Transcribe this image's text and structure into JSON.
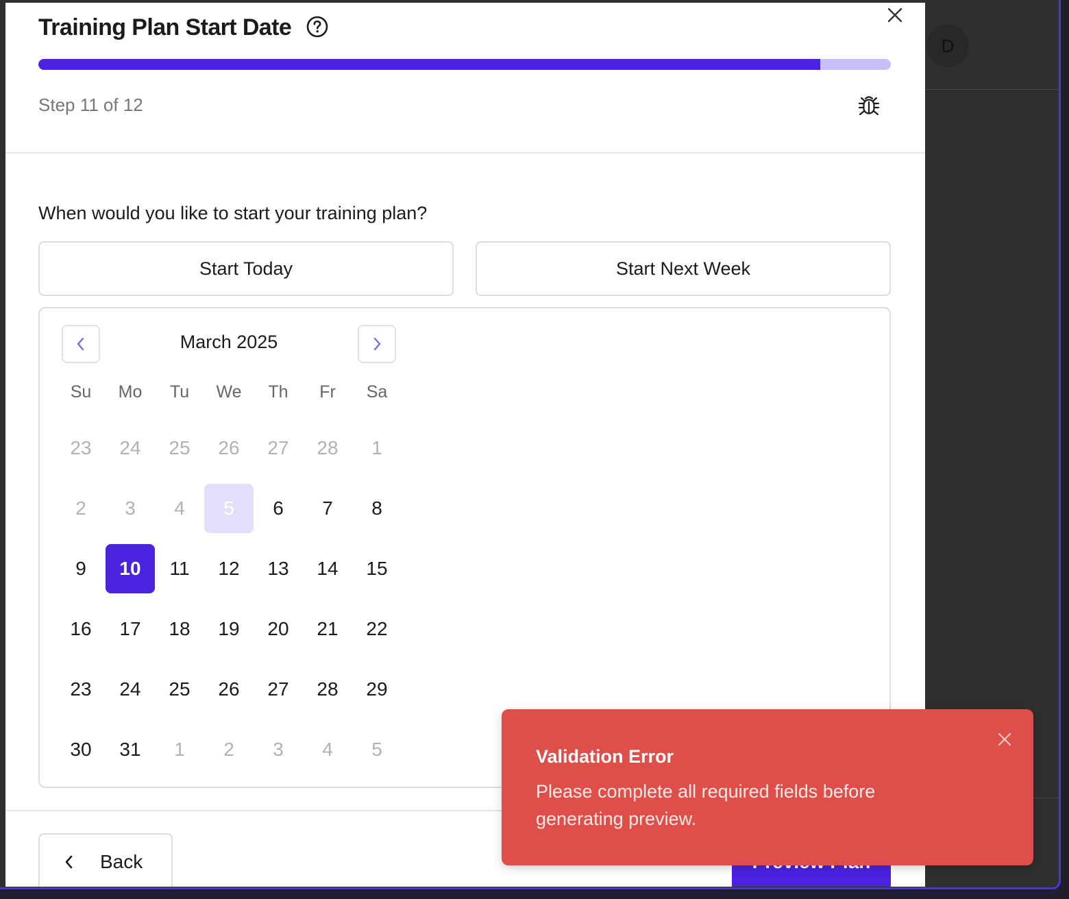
{
  "background": {
    "avatar_initial": "D"
  },
  "modal": {
    "title": "Training Plan Start Date",
    "step_text": "Step 11 of 12",
    "progress_fraction": 0.917,
    "question": "When would you like to start your training plan?",
    "quick_options": [
      "Start Today",
      "Start Next Week"
    ]
  },
  "calendar": {
    "month_label": "March 2025",
    "weekdays": [
      "Su",
      "Mo",
      "Tu",
      "We",
      "Th",
      "Fr",
      "Sa"
    ],
    "days": [
      {
        "d": "23",
        "s": "muted"
      },
      {
        "d": "24",
        "s": "muted"
      },
      {
        "d": "25",
        "s": "muted"
      },
      {
        "d": "26",
        "s": "muted"
      },
      {
        "d": "27",
        "s": "muted"
      },
      {
        "d": "28",
        "s": "muted"
      },
      {
        "d": "1",
        "s": "muted"
      },
      {
        "d": "2",
        "s": "muted"
      },
      {
        "d": "3",
        "s": "muted"
      },
      {
        "d": "4",
        "s": "muted"
      },
      {
        "d": "5",
        "s": "today"
      },
      {
        "d": "6",
        "s": ""
      },
      {
        "d": "7",
        "s": ""
      },
      {
        "d": "8",
        "s": ""
      },
      {
        "d": "9",
        "s": ""
      },
      {
        "d": "10",
        "s": "selected"
      },
      {
        "d": "11",
        "s": ""
      },
      {
        "d": "12",
        "s": ""
      },
      {
        "d": "13",
        "s": ""
      },
      {
        "d": "14",
        "s": ""
      },
      {
        "d": "15",
        "s": ""
      },
      {
        "d": "16",
        "s": ""
      },
      {
        "d": "17",
        "s": ""
      },
      {
        "d": "18",
        "s": ""
      },
      {
        "d": "19",
        "s": ""
      },
      {
        "d": "20",
        "s": ""
      },
      {
        "d": "21",
        "s": ""
      },
      {
        "d": "22",
        "s": ""
      },
      {
        "d": "23",
        "s": ""
      },
      {
        "d": "24",
        "s": ""
      },
      {
        "d": "25",
        "s": ""
      },
      {
        "d": "26",
        "s": ""
      },
      {
        "d": "27",
        "s": ""
      },
      {
        "d": "28",
        "s": ""
      },
      {
        "d": "29",
        "s": ""
      },
      {
        "d": "30",
        "s": ""
      },
      {
        "d": "31",
        "s": ""
      },
      {
        "d": "1",
        "s": "muted"
      },
      {
        "d": "2",
        "s": "muted"
      },
      {
        "d": "3",
        "s": "muted"
      },
      {
        "d": "4",
        "s": "muted"
      },
      {
        "d": "5",
        "s": "muted"
      }
    ]
  },
  "footer": {
    "back_label": "Back",
    "next_label": "Preview Plan"
  },
  "toast": {
    "title": "Validation Error",
    "message": "Please complete all required fields before generating preview."
  },
  "colors": {
    "accent": "#4a23e0",
    "accent_light": "#c8bff6",
    "error": "#dd4f48"
  }
}
